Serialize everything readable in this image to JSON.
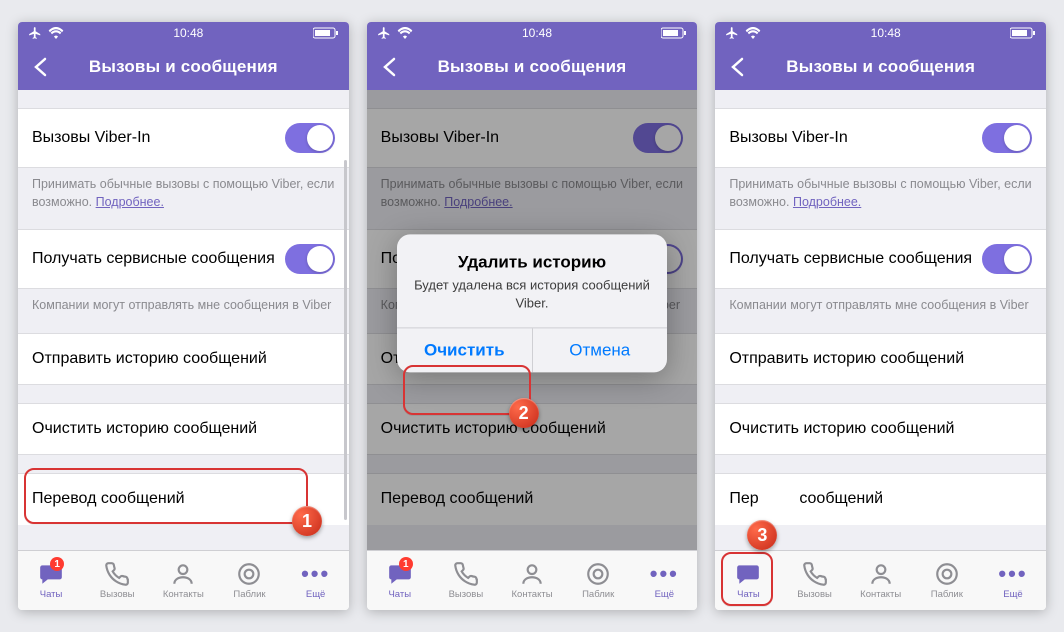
{
  "status": {
    "time": "10:48"
  },
  "header": {
    "title": "Вызовы и сообщения"
  },
  "rows": {
    "viber_in": "Вызовы Viber-In",
    "viber_in_note_a": "Принимать обычные вызовы с помощью Viber, если возможно. ",
    "viber_in_note_link": "Подробнее.",
    "service_msgs": "Получать сервисные сообщения",
    "service_note": "Компании могут отправлять мне сообщения в Viber",
    "send_history": "Отправить историю сообщений",
    "clear_history": "Очистить историю сообщений",
    "translation": "Перевод сообщений",
    "translation_short": "Пер",
    "translation_rest": "сообщений"
  },
  "alert": {
    "title": "Удалить историю",
    "message": "Будет удалена вся история сообщений Viber.",
    "ok": "Очистить",
    "cancel": "Отмена"
  },
  "tabs": {
    "chats": "Чаты",
    "calls": "Вызовы",
    "contacts": "Контакты",
    "public": "Паблик",
    "more": "Ещё",
    "badge": "1"
  },
  "badges": {
    "b1": "1",
    "b2": "2",
    "b3": "3"
  }
}
